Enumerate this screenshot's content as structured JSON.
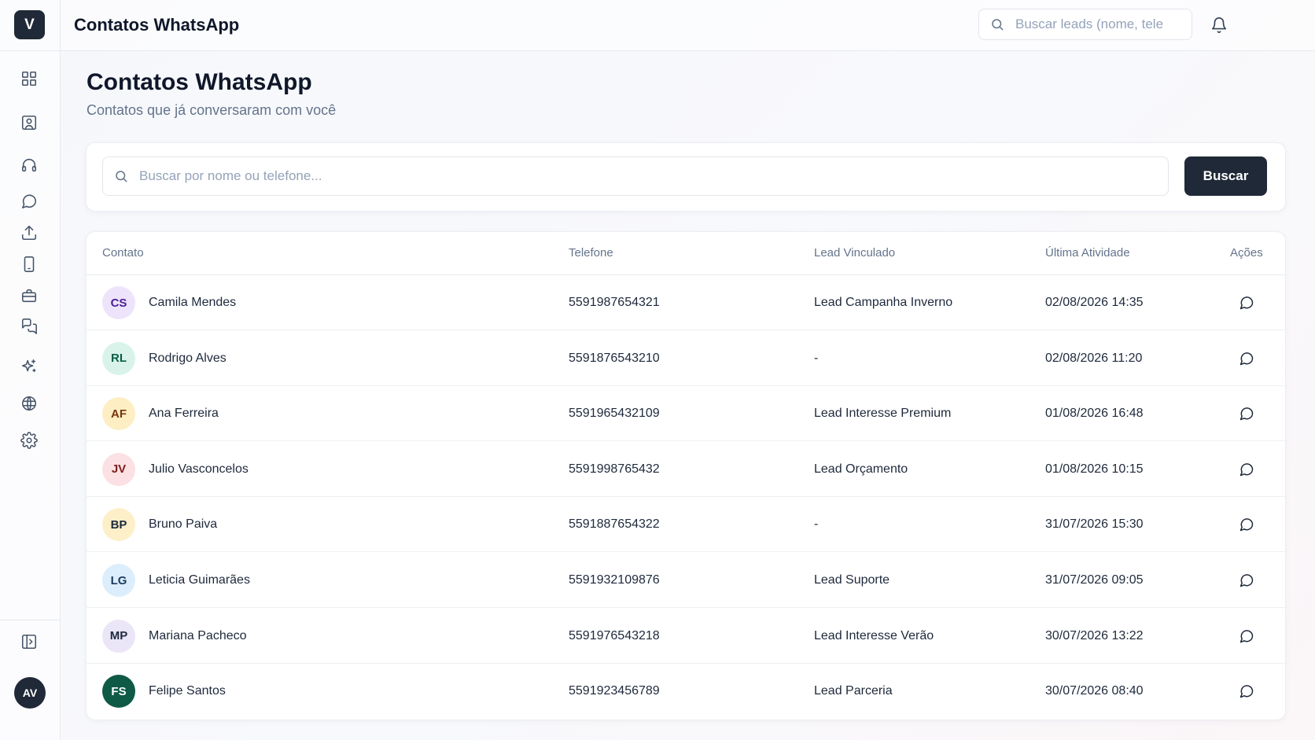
{
  "app": {
    "logo_letter": "V",
    "title": "Contatos WhatsApp",
    "user_initials": "AV"
  },
  "sidebar": {
    "icons": [
      "grid-icon",
      "contacts-icon",
      "headset-icon",
      "chat-icon",
      "upload-icon",
      "phone-icon",
      "briefcase-icon",
      "messages-icon",
      "sparkles-icon",
      "globe-icon",
      "settings-icon"
    ],
    "collapse_icon": "panel-toggle-icon"
  },
  "topbar": {
    "search_placeholder": "Buscar leads (nome, tele"
  },
  "page": {
    "title": "Contatos WhatsApp",
    "subtitle": "Contatos que já conversaram com você"
  },
  "search": {
    "placeholder": "Buscar por nome ou telefone...",
    "button_label": "Buscar"
  },
  "table": {
    "headers": {
      "contact": "Contato",
      "phone": "Telefone",
      "lead": "Lead Vinculado",
      "activity": "Última Atividade",
      "actions": "Ações"
    },
    "rows": [
      {
        "initials": "CS",
        "name": "Camila Mendes",
        "phone": "5591987654321",
        "lead": "Lead Campanha Inverno",
        "activity": "02/08/2026 14:35",
        "avatar_bg": "#ede4fb",
        "avatar_fg": "#4c1d95"
      },
      {
        "initials": "RL",
        "name": "Rodrigo Alves",
        "phone": "5591876543210",
        "lead": "-",
        "activity": "02/08/2026 11:20",
        "avatar_bg": "#d9f3ea",
        "avatar_fg": "#065f46"
      },
      {
        "initials": "AF",
        "name": "Ana Ferreira",
        "phone": "5591965432109",
        "lead": "Lead Interesse Premium",
        "activity": "01/08/2026 16:48",
        "avatar_bg": "#fdefc3",
        "avatar_fg": "#78350f"
      },
      {
        "initials": "JV",
        "name": "Julio Vasconcelos",
        "phone": "5591998765432",
        "lead": "Lead Orçamento",
        "activity": "01/08/2026 10:15",
        "avatar_bg": "#fbe1e3",
        "avatar_fg": "#7f1d1d"
      },
      {
        "initials": "BP",
        "name": "Bruno Paiva",
        "phone": "5591887654322",
        "lead": "-",
        "activity": "31/07/2026 15:30",
        "avatar_bg": "#fdf0c9",
        "avatar_fg": "#1e293b"
      },
      {
        "initials": "LG",
        "name": "Leticia Guimarães",
        "phone": "5591932109876",
        "lead": "Lead Suporte",
        "activity": "31/07/2026 09:05",
        "avatar_bg": "#dceefb",
        "avatar_fg": "#1e3a5f"
      },
      {
        "initials": "MP",
        "name": "Mariana Pacheco",
        "phone": "5591976543218",
        "lead": "Lead Interesse Verão",
        "activity": "30/07/2026 13:22",
        "avatar_bg": "#ebe5f8",
        "avatar_fg": "#1e293b"
      },
      {
        "initials": "FS",
        "name": "Felipe Santos",
        "phone": "5591923456789",
        "lead": "Lead Parceria",
        "activity": "30/07/2026 08:40",
        "avatar_bg": "#0f5a46",
        "avatar_fg": "#ffffff"
      }
    ]
  },
  "colors": {
    "primary": "#1f2937",
    "muted_text": "#64748b",
    "border": "#e7e9ef"
  }
}
